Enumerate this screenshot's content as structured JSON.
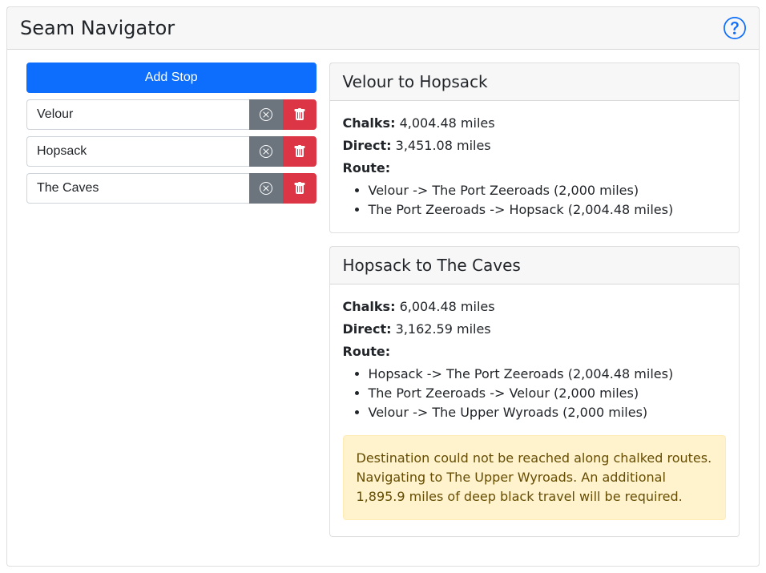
{
  "app": {
    "title": "Seam Navigator"
  },
  "sidebar": {
    "add_stop_label": "Add Stop",
    "stops": [
      {
        "name": "Velour"
      },
      {
        "name": "Hopsack"
      },
      {
        "name": "The Caves"
      }
    ]
  },
  "legs": [
    {
      "title": "Velour to Hopsack",
      "chalks_label": "Chalks:",
      "chalks_value": "4,004.48 miles",
      "direct_label": "Direct:",
      "direct_value": "3,451.08 miles",
      "route_label": "Route:",
      "route": [
        "Velour -> The Port Zeeroads (2,000 miles)",
        "The Port Zeeroads -> Hopsack (2,004.48 miles)"
      ],
      "warning": null
    },
    {
      "title": "Hopsack to The Caves",
      "chalks_label": "Chalks:",
      "chalks_value": "6,004.48 miles",
      "direct_label": "Direct:",
      "direct_value": "3,162.59 miles",
      "route_label": "Route:",
      "route": [
        "Hopsack -> The Port Zeeroads (2,004.48 miles)",
        "The Port Zeeroads -> Velour (2,000 miles)",
        "Velour -> The Upper Wyroads (2,000 miles)"
      ],
      "warning": "Destination could not be reached along chalked routes. Navigating to The Upper Wyroads. An additional 1,895.9 miles of deep black travel will be required."
    }
  ]
}
